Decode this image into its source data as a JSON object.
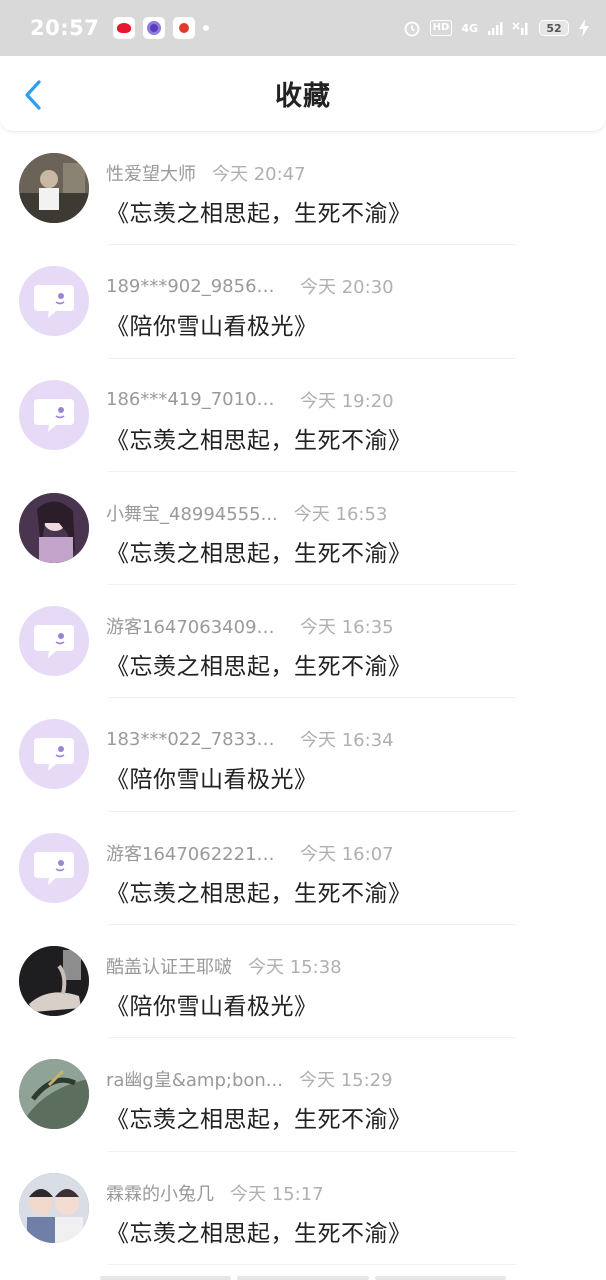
{
  "status_bar": {
    "time": "20:57",
    "app_icons": [
      "weibo-icon",
      "browser-icon",
      "maps-icon"
    ],
    "hd_label": "HD",
    "network_label": "4G",
    "battery": "52"
  },
  "header": {
    "back_icon": "chevron-left-icon",
    "title": "收藏"
  },
  "accent_colors": {
    "back": "#2a9df4",
    "avatar_default": "#e7daf7",
    "avatar_glyph": "#ffffff"
  },
  "items": [
    {
      "avatar": "photo",
      "user": "性爱望大师",
      "time": "今天 20:47",
      "message": "《忘羡之相思起，生死不渝》"
    },
    {
      "avatar": "default",
      "user": "189***902_98565...",
      "time": "今天 20:30",
      "message": "《陪你雪山看极光》"
    },
    {
      "avatar": "default",
      "user": "186***419_70107...",
      "time": "今天 19:20",
      "message": "《忘羡之相思起，生死不渝》"
    },
    {
      "avatar": "photo",
      "user": "小舞宝_48994555...",
      "time": "今天 16:53",
      "message": "《忘羡之相思起，生死不渝》"
    },
    {
      "avatar": "default",
      "user": "游客16470634097...",
      "time": "今天 16:35",
      "message": "《忘羡之相思起，生死不渝》"
    },
    {
      "avatar": "default",
      "user": "183***022_78332...",
      "time": "今天 16:34",
      "message": "《陪你雪山看极光》"
    },
    {
      "avatar": "default",
      "user": "游客16470622213...",
      "time": "今天 16:07",
      "message": "《忘羡之相思起，生死不渝》"
    },
    {
      "avatar": "photo",
      "user": "酷盖认证王耶啵",
      "time": "今天 15:38",
      "message": "《陪你雪山看极光》"
    },
    {
      "avatar": "photo",
      "user": "ra幽g皇&amp;bon...",
      "time": "今天 15:29",
      "message": "《忘羡之相思起，生死不渝》"
    },
    {
      "avatar": "photo",
      "user": "霖霖的小兔几",
      "time": "今天 15:17",
      "message": "《忘羡之相思起，生死不渝》"
    }
  ]
}
